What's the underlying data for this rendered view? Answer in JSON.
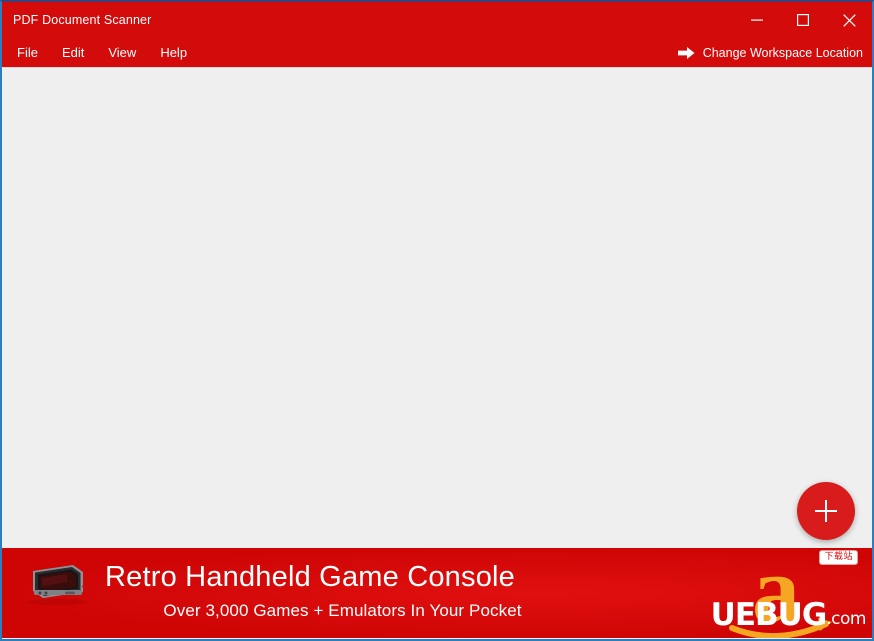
{
  "window": {
    "title": "PDF Document Scanner",
    "controls": {
      "minimize_label": "Minimize",
      "maximize_label": "Maximize",
      "close_label": "Close"
    }
  },
  "menu": {
    "items": [
      {
        "label": "File"
      },
      {
        "label": "Edit"
      },
      {
        "label": "View"
      },
      {
        "label": "Help"
      }
    ],
    "workspace_action": {
      "label": "Change Workspace Location",
      "icon": "arrow-right-icon"
    }
  },
  "content": {
    "fab": {
      "icon": "plus-icon",
      "label": "Add"
    }
  },
  "ad_banner": {
    "thumbnail_icon": "handheld-console-icon",
    "headline": "Retro Handheld Game Console",
    "subhead": "Over 3,000 Games + Emulators In Your Pocket",
    "brand_mark": "amazon-a-icon",
    "watermark": {
      "text": "UEBUG",
      "suffix": ".com",
      "badge": "下载站"
    }
  },
  "colors": {
    "chrome_red": "#d30b0b",
    "banner_red": "#d40707",
    "fab_red": "#d81c1c",
    "content_bg": "#efeff0",
    "border_blue": "#2a7fbe",
    "amazon_orange": "#f5a623",
    "text_white": "#ffffff"
  }
}
